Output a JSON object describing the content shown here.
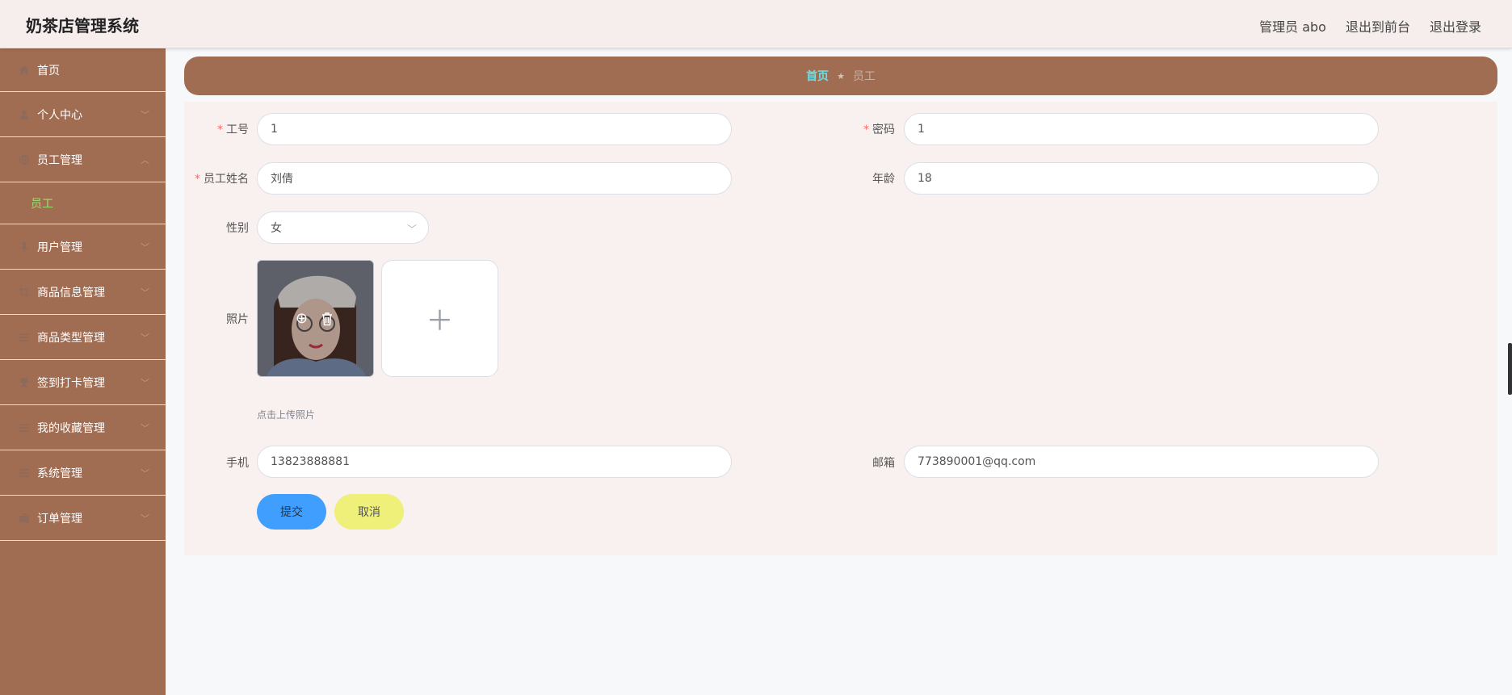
{
  "header": {
    "title": "奶茶店管理系统",
    "admin": "管理员 abo",
    "to_front": "退出到前台",
    "logout": "退出登录"
  },
  "sidebar": {
    "items": [
      {
        "label": "首页",
        "icon": "home-icon"
      },
      {
        "label": "个人中心",
        "icon": "user-icon"
      },
      {
        "label": "员工管理",
        "icon": "globe-icon",
        "expanded": true,
        "sub": [
          "员工"
        ]
      },
      {
        "label": "用户管理",
        "icon": "mic-icon"
      },
      {
        "label": "商品信息管理",
        "icon": "crop-icon"
      },
      {
        "label": "商品类型管理",
        "icon": "list-icon"
      },
      {
        "label": "签到打卡管理",
        "icon": "stamp-icon"
      },
      {
        "label": "我的收藏管理",
        "icon": "list-icon"
      },
      {
        "label": "系统管理",
        "icon": "sliders-icon"
      },
      {
        "label": "订单管理",
        "icon": "briefcase-icon"
      }
    ]
  },
  "breadcrumb": {
    "home": "首页",
    "current": "员工"
  },
  "form": {
    "job_no": {
      "label": "工号",
      "value": "1",
      "required": true
    },
    "password": {
      "label": "密码",
      "value": "1",
      "required": true
    },
    "name": {
      "label": "员工姓名",
      "value": "刘倩",
      "required": true
    },
    "age": {
      "label": "年龄",
      "value": "18"
    },
    "gender": {
      "label": "性别",
      "value": "女"
    },
    "photo": {
      "label": "照片",
      "tip": "点击上传照片"
    },
    "phone": {
      "label": "手机",
      "value": "13823888881"
    },
    "email": {
      "label": "邮箱",
      "value": "773890001@qq.com"
    },
    "submit": "提交",
    "cancel": "取消"
  },
  "colors": {
    "sidebar": "#a06d53",
    "submit": "#409eff",
    "cancel": "#eef07a",
    "active_sub": "#9be06d"
  }
}
